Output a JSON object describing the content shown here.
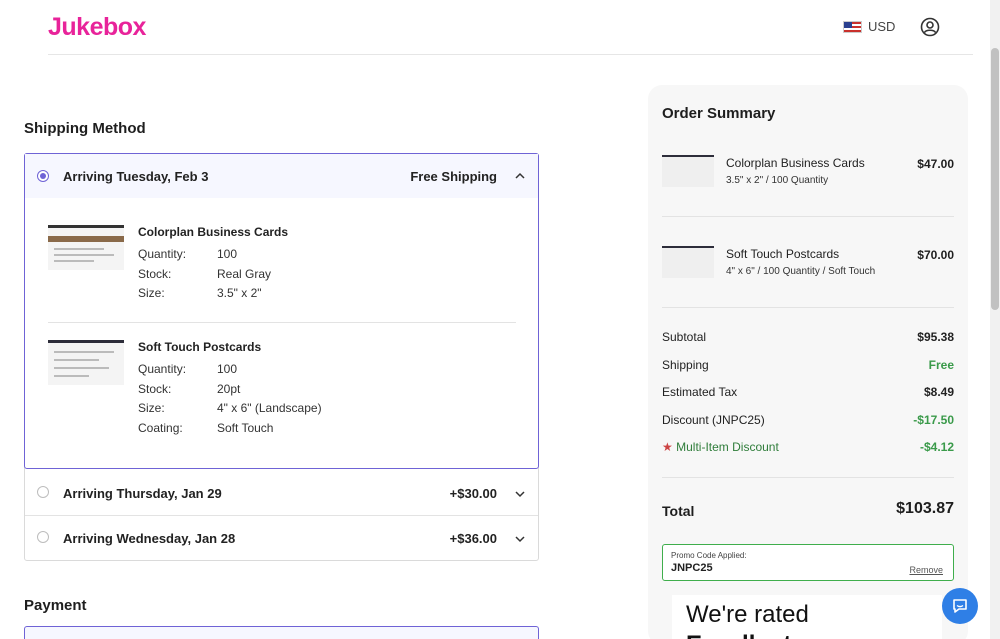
{
  "brand": {
    "logo_text": "Jukebox",
    "logo_color": "#e8239a"
  },
  "header": {
    "currency": "USD"
  },
  "shipping": {
    "title": "Shipping Method",
    "options": [
      {
        "label": "Arriving Tuesday, Feb 3",
        "price": "Free Shipping",
        "selected": true
      },
      {
        "label": "Arriving Thursday, Jan 29",
        "price": "+$30.00",
        "selected": false
      },
      {
        "label": "Arriving Wednesday, Jan 28",
        "price": "+$36.00",
        "selected": false
      }
    ],
    "items": [
      {
        "name": "Colorplan Business Cards",
        "specs": [
          {
            "label": "Quantity:",
            "value": "100"
          },
          {
            "label": "Stock:",
            "value": "Real Gray"
          },
          {
            "label": "Size:",
            "value": "3.5\" x 2\""
          }
        ]
      },
      {
        "name": "Soft Touch Postcards",
        "specs": [
          {
            "label": "Quantity:",
            "value": "100"
          },
          {
            "label": "Stock:",
            "value": "20pt"
          },
          {
            "label": "Size:",
            "value": "4\" x 6\" (Landscape)"
          },
          {
            "label": "Coating:",
            "value": "Soft Touch"
          }
        ]
      }
    ]
  },
  "payment": {
    "title": "Payment"
  },
  "summary": {
    "title": "Order Summary",
    "items": [
      {
        "name": "Colorplan Business Cards",
        "sub": "3.5\" x 2\" / 100 Quantity",
        "price": "$47.00"
      },
      {
        "name": "Soft Touch Postcards",
        "sub": "4\" x 6\" / 100 Quantity / Soft Touch",
        "price": "$70.00"
      }
    ],
    "rows": [
      {
        "label": "Subtotal",
        "value": "$95.38"
      },
      {
        "label": "Shipping",
        "value": "Free"
      },
      {
        "label": "Estimated Tax",
        "value": "$8.49"
      },
      {
        "label": "Discount (JNPC25)",
        "value": "-$17.50"
      },
      {
        "label": "Multi-Item Discount",
        "value": "-$4.12"
      }
    ],
    "total_label": "Total",
    "total_value": "$103.87",
    "promo": {
      "caption": "Promo Code Applied:",
      "code": "JNPC25",
      "remove": "Remove"
    },
    "rated_line1": "We're rated",
    "rated_line2": "Excellent"
  },
  "colors": {
    "accent": "#6f63d6",
    "green": "#3a9a4a",
    "chat": "#2f7fe6"
  }
}
